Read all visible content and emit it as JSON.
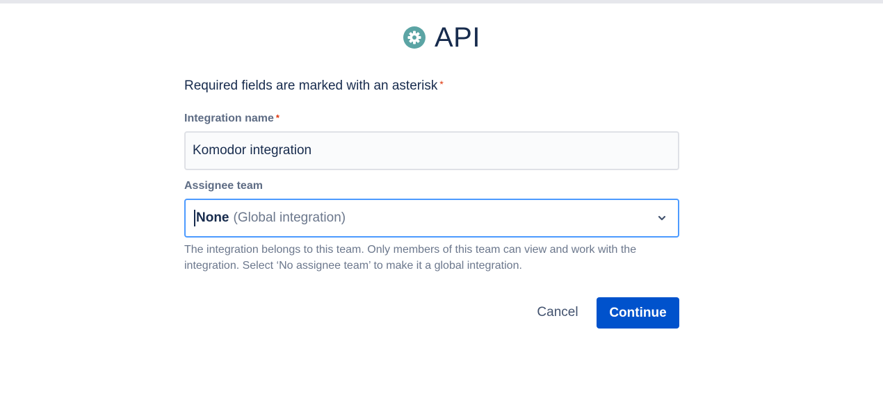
{
  "header": {
    "title": "API",
    "icon": "gear-icon",
    "icon_color": "#5ba4a4"
  },
  "form": {
    "required_note": "Required fields are marked with an asterisk",
    "asterisk": "*",
    "integration_name": {
      "label": "Integration name",
      "value": "Komodor integration"
    },
    "assignee_team": {
      "label": "Assignee team",
      "selected_value": "None",
      "selected_hint": "(Global integration)",
      "help_text": "The integration belongs to this team. Only members of this team can view and work with the integration. Select ‘No assignee team’ to make it a global integration."
    },
    "buttons": {
      "cancel_label": "Cancel",
      "continue_label": "Continue"
    }
  },
  "colors": {
    "primary": "#0052cc",
    "required": "#de350b",
    "focus_border": "#4c9aff",
    "text": "#172b4d",
    "muted_text": "#6b778c"
  }
}
